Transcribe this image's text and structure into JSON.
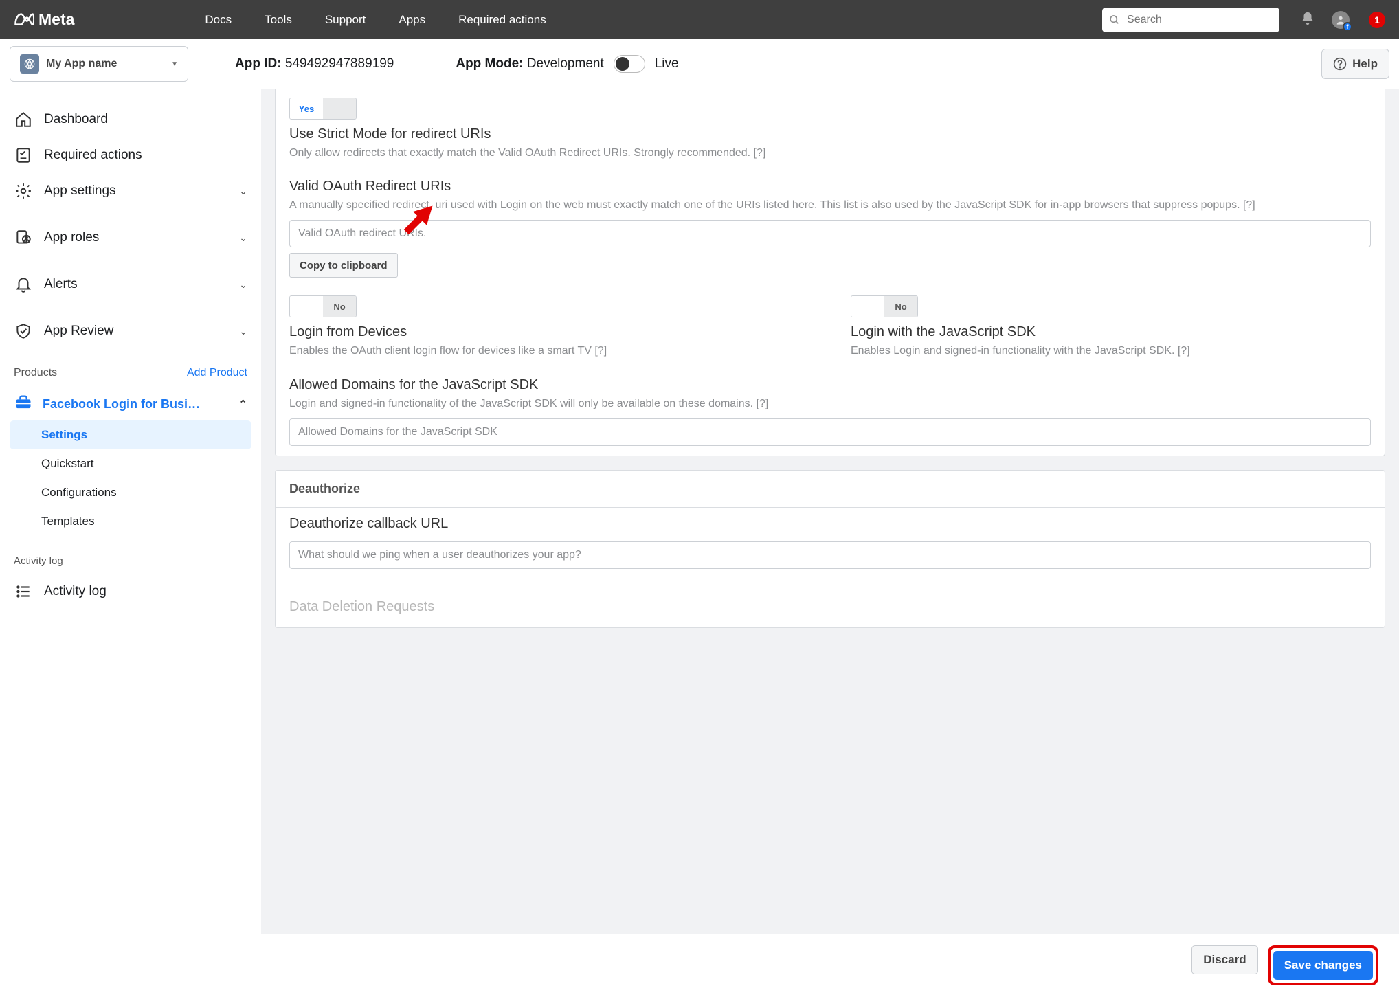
{
  "topnav": {
    "brand": "Meta",
    "links": [
      "Docs",
      "Tools",
      "Support",
      "Apps",
      "Required actions"
    ],
    "search_placeholder": "Search",
    "notif_count": "1"
  },
  "subheader": {
    "app_name": "My App name",
    "appid_label": "App ID:",
    "appid_value": "549492947889199",
    "mode_label": "App Mode:",
    "mode_value": "Development",
    "mode_alt": "Live",
    "help": "Help"
  },
  "sidebar": {
    "items": [
      {
        "label": "Dashboard"
      },
      {
        "label": "Required actions"
      },
      {
        "label": "App settings",
        "expandable": true
      },
      {
        "label": "App roles",
        "expandable": true
      },
      {
        "label": "Alerts",
        "expandable": true
      },
      {
        "label": "App Review",
        "expandable": true
      }
    ],
    "products_label": "Products",
    "add_product": "Add Product",
    "product_name": "Facebook Login for Busi…",
    "subitems": [
      "Settings",
      "Quickstart",
      "Configurations",
      "Templates"
    ],
    "activity_header": "Activity log",
    "activity_item": "Activity log"
  },
  "settings": {
    "strict": {
      "yes": "Yes",
      "title": "Use Strict Mode for redirect URIs",
      "desc": "Only allow redirects that exactly match the Valid OAuth Redirect URIs. Strongly recommended.  [?]"
    },
    "redirect": {
      "title": "Valid OAuth Redirect URIs",
      "desc": "A manually specified redirect_uri used with Login on the web must exactly match one of the URIs listed here. This list is also used by the JavaScript SDK for in-app browsers that suppress popups.  [?]",
      "placeholder": "Valid OAuth redirect URIs.",
      "copy": "Copy to clipboard"
    },
    "devices": {
      "no": "No",
      "title": "Login from Devices",
      "desc": "Enables the OAuth client login flow for devices like a smart TV [?]"
    },
    "jssdk": {
      "no": "No",
      "title": "Login with the JavaScript SDK",
      "desc": "Enables Login and signed-in functionality with the JavaScript SDK.  [?]"
    },
    "allowed": {
      "title": "Allowed Domains for the JavaScript SDK",
      "desc": "Login and signed-in functionality of the JavaScript SDK will only be available on these domains.  [?]",
      "placeholder": "Allowed Domains for the JavaScript SDK"
    },
    "deauth": {
      "header": "Deauthorize",
      "title": "Deauthorize callback URL",
      "placeholder": "What should we ping when a user deauthorizes your app?"
    },
    "deletion_header": "Data Deletion Requests",
    "discard": "Discard",
    "save": "Save changes"
  }
}
